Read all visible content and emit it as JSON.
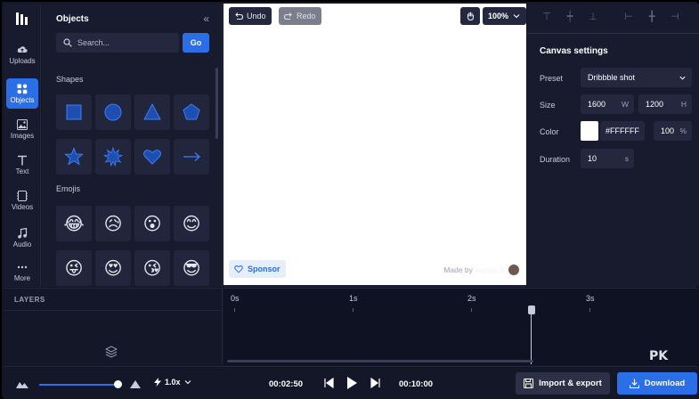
{
  "rail": {
    "items": [
      {
        "label": "Uploads",
        "icon": "upload-cloud-icon",
        "active": false
      },
      {
        "label": "Objects",
        "icon": "objects-icon",
        "active": true
      },
      {
        "label": "Images",
        "icon": "image-icon",
        "active": false
      },
      {
        "label": "Text",
        "icon": "text-icon",
        "active": false
      },
      {
        "label": "Videos",
        "icon": "video-icon",
        "active": false
      },
      {
        "label": "Audio",
        "icon": "music-note-icon",
        "active": false
      },
      {
        "label": "More",
        "icon": "more-dots-icon",
        "active": false
      }
    ]
  },
  "objects": {
    "title": "Objects",
    "search_placeholder": "Search...",
    "go_label": "Go",
    "shapes_heading": "Shapes",
    "shapes": [
      "square",
      "circle",
      "triangle",
      "pentagon",
      "star",
      "starburst",
      "heart",
      "arrow"
    ],
    "emojis_heading": "Emojis",
    "emojis": [
      "😂",
      "😥",
      "😮",
      "😊",
      "😜",
      "😍",
      "😘",
      "😎"
    ]
  },
  "toolbar": {
    "undo_label": "Undo",
    "redo_label": "Redo",
    "zoom_label": "100%"
  },
  "canvas": {
    "sponsor_label": "Sponsor",
    "madeby_prefix": "Made by",
    "madeby_name": "Alyssa X"
  },
  "settings": {
    "title": "Canvas settings",
    "preset_label": "Preset",
    "preset_value": "Dribbble shot",
    "size_label": "Size",
    "width_value": "1600",
    "width_unit": "W",
    "height_value": "1200",
    "height_unit": "H",
    "color_label": "Color",
    "color_value": "#FFFFFF",
    "opacity_value": "100",
    "opacity_unit": "%",
    "duration_label": "Duration",
    "duration_value": "10",
    "duration_unit": "s"
  },
  "timeline": {
    "layers_title": "LAYERS",
    "ticks": [
      "0s",
      "1s",
      "2s",
      "3s"
    ]
  },
  "footer": {
    "speed": "1.0x",
    "current_time": "00:02:50",
    "total_time": "00:10:00",
    "import_export_label": "Import & export",
    "download_label": "Download"
  },
  "watermark": "PK",
  "colors": {
    "accent": "#2a6ee8",
    "panel": "#181b2e",
    "background": "#0f1223"
  }
}
